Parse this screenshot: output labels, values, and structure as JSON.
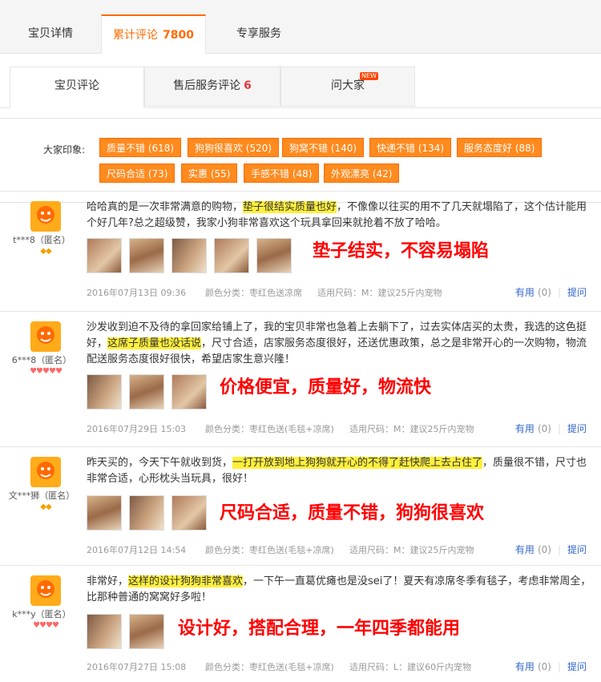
{
  "tabs": {
    "details": "宝贝详情",
    "reviews": "累计评论",
    "reviews_count": "7800",
    "service": "专享服务"
  },
  "subtabs": {
    "item": "宝贝评论",
    "aftersale": "售后服务评论",
    "aftersale_count": "6",
    "ask": "问大家",
    "new_badge": "NEW"
  },
  "impressions": {
    "label": "大家印象:",
    "tags": [
      "质量不错 (618)",
      "狗狗很喜欢 (520)",
      "狗窝不错 (140)",
      "快递不错 (134)",
      "服务态度好 (88)",
      "尺码合适 (73)",
      "实惠 (55)",
      "手感不错 (48)",
      "外观漂亮 (42)"
    ]
  },
  "reviews": [
    {
      "user": "t***8（匿名）",
      "badges": "◆◆",
      "text_before": "哈哈真的是一次非常满意的购物，",
      "text_highlight": "垫子很结实质量也好",
      "text_after": "，不像像以往买的用不了几天就塌陷了，这个估计能用个好几年?总之超级赞，我家小狗非常喜欢这个玩具拿回来就抢着不放了哈哈。",
      "summary": "垫子结实，不容易塌陷",
      "date": "2016年07月13日 09:36",
      "color": "颜色分类：枣红色送凉席",
      "size": "适用尺码：M：建议25斤内宠物",
      "useful": "有用",
      "useful_count": "(0)",
      "ask": "提问"
    },
    {
      "user": "6***8（匿名）",
      "badges": "♥♥♥♥♥",
      "text_before": "沙发收到迫不及待的拿回家给铺上了，我的宝贝非常也急着上去躺下了，过去实体店买的太贵，我选的这色挺好，",
      "text_highlight": "这席子质量也没话说",
      "text_after": "，尺寸合适，店家服务态度很好，还送优惠政策，总之是非常开心的一次购物，物流配送服务态度很好很快，希望店家生意兴隆！",
      "summary": "价格便宜，质量好，物流快",
      "date": "2016年07月29日 15:03",
      "color": "颜色分类：枣红色送(毛毯+凉席)",
      "size": "适用尺码：M：建议25斤内宠物",
      "useful": "有用",
      "useful_count": "(0)",
      "ask": "提问"
    },
    {
      "user": "文***狮（匿名）",
      "badges": "◆◆",
      "text_before": "昨天买的，今天下午就收到货，",
      "text_highlight": "一打开放到地上狗狗就开心的不得了赶快爬上去占住了",
      "text_after": "，质量很不错，尺寸也非常合适，心形枕头当玩具，很好！",
      "summary": "尺码合适，质量不错，狗狗很喜欢",
      "date": "2016年07月12日 14:54",
      "color": "颜色分类：枣红色送(毛毯+凉席)",
      "size": "适用尺码：M：建议25斤内宠物",
      "useful": "有用",
      "useful_count": "(0)",
      "ask": "提问"
    },
    {
      "user": "k***y（匿名）",
      "badges": "♥♥♥♥",
      "text_before": "非常好，",
      "text_highlight": "这样的设计狗狗非常喜欢",
      "text_after": "，一下午一直葛优瘫也是没sei了！夏天有凉席冬季有毯子，考虑非常周全，比那种普通的窝窝好多啦！",
      "summary": "设计好，搭配合理，一年四季都能用",
      "date": "2016年07月27日 15:08",
      "color": "颜色分类：枣红色送(毛毯+凉席)",
      "size": "适用尺码：L：建议60斤内宠物",
      "useful": "有用",
      "useful_count": "(0)",
      "ask": "提问"
    }
  ]
}
